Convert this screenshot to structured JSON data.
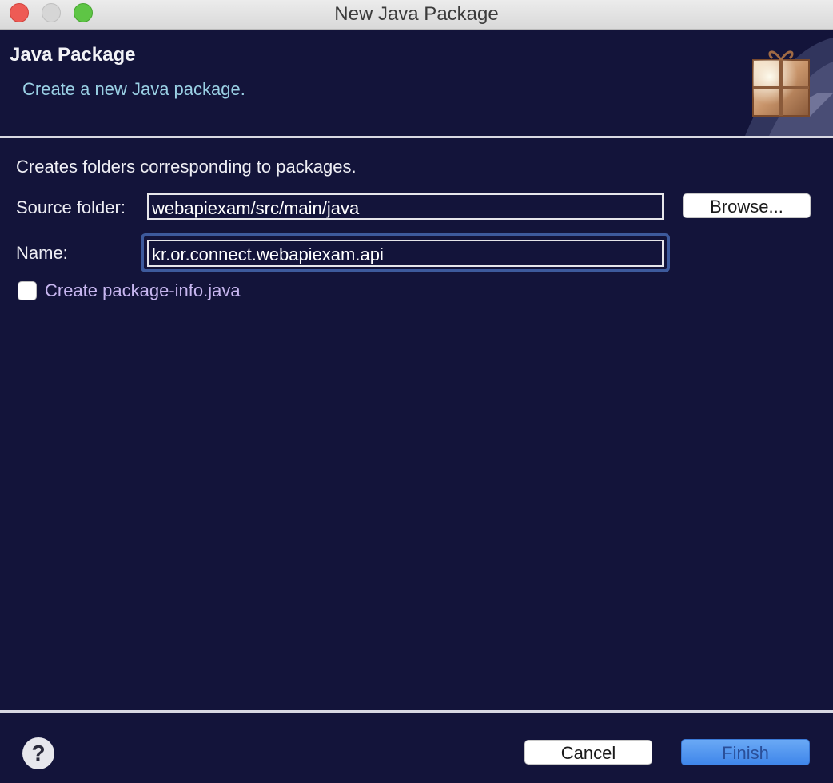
{
  "window": {
    "title": "New Java Package"
  },
  "banner": {
    "title": "Java Package",
    "description": "Create a new Java package.",
    "icon": "package-icon"
  },
  "body": {
    "description": "Creates folders corresponding to packages.",
    "source_folder": {
      "label": "Source folder:",
      "value": "webapiexam/src/main/java",
      "browse_label": "Browse..."
    },
    "name": {
      "label": "Name:",
      "value": "kr.or.connect.webapiexam.api"
    },
    "package_info": {
      "label": "Create package-info.java",
      "checked": false
    }
  },
  "footer": {
    "help_glyph": "?",
    "cancel_label": "Cancel",
    "finish_label": "Finish"
  },
  "colors": {
    "background": "#13143a",
    "accent": "#3f86ea",
    "description_text": "#9ad0e4"
  }
}
